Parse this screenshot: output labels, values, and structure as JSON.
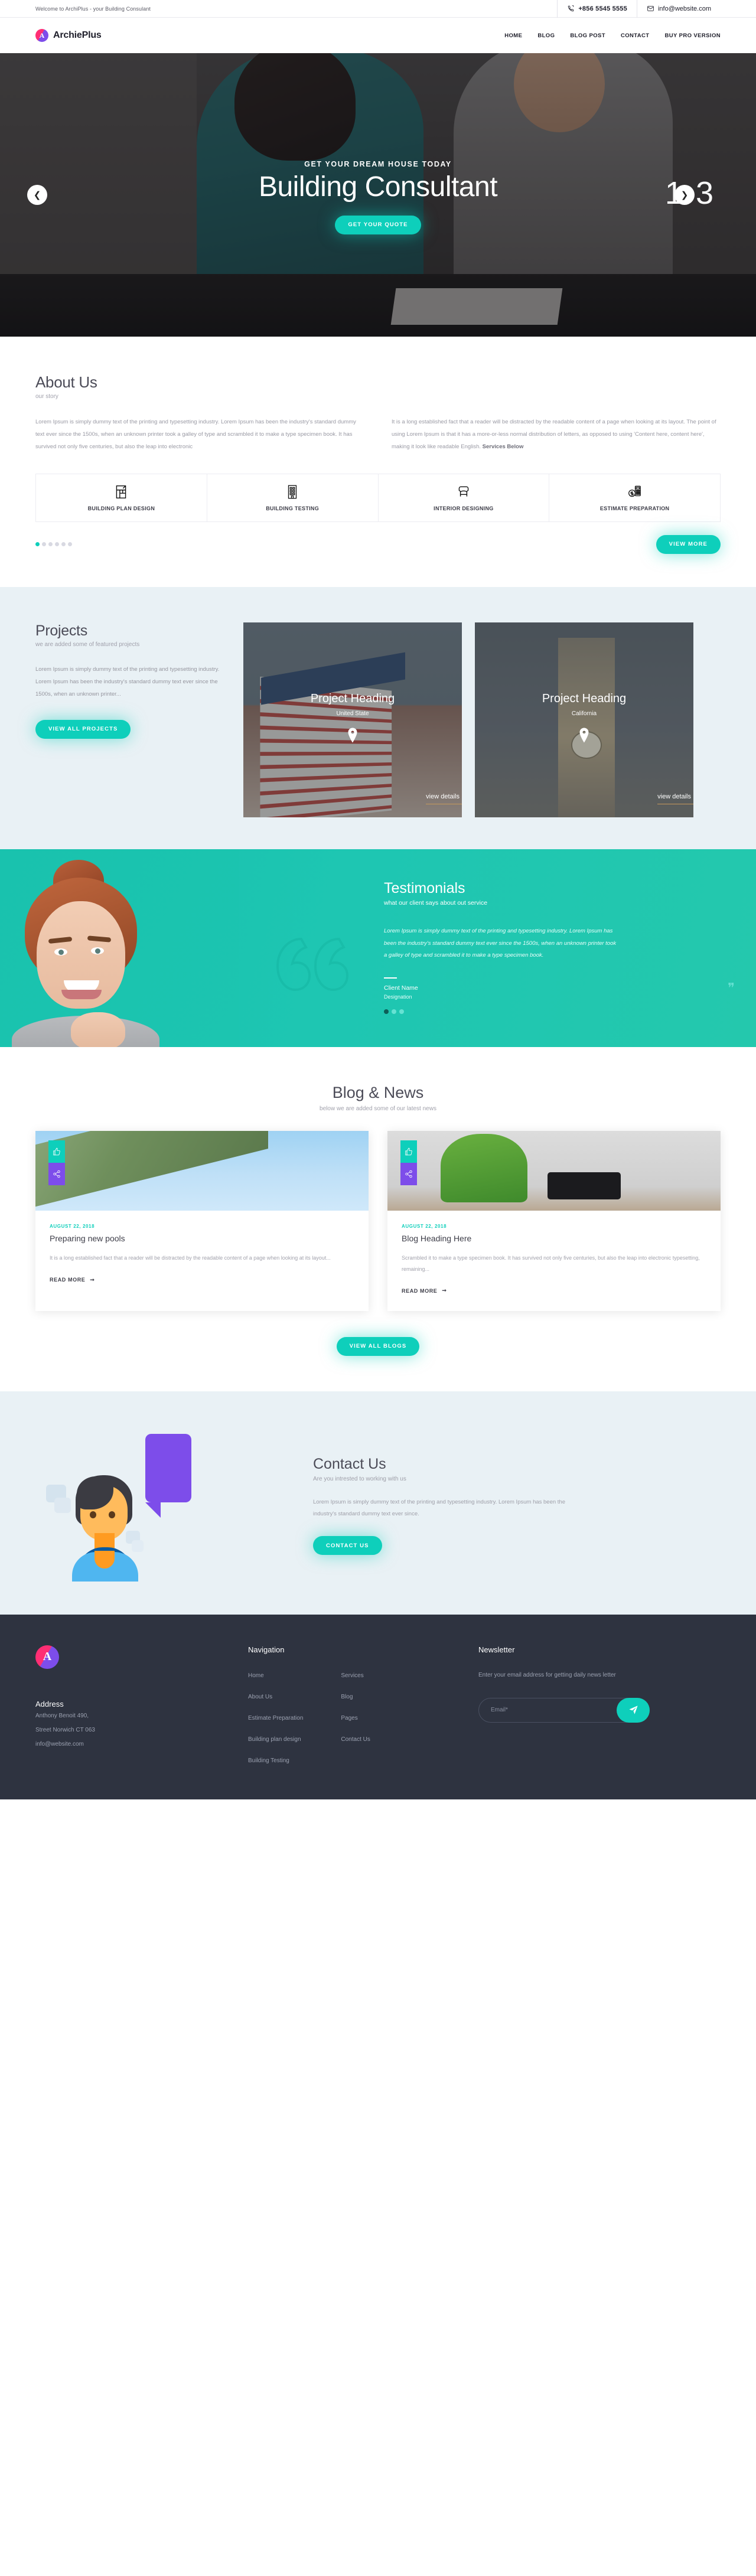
{
  "topbar": {
    "welcome": "Welcome to ArchiPlus - your Building Consulant",
    "phone": "+856 5545 5555",
    "email": "info@website.com",
    "phone_icon": "phone-icon",
    "mail_icon": "mail-icon"
  },
  "brand": {
    "initial": "A",
    "name": "ArchiePlus"
  },
  "nav": {
    "items": [
      "HOME",
      "BLOG",
      "BLOG POST",
      "CONTACT",
      "BUY PRO VERSION"
    ]
  },
  "hero": {
    "kicker": "GET YOUR DREAM HOUSE TODAY",
    "title": "Building Consultant",
    "cta": "GET YOUR QUOTE",
    "prev_icon": "chevron-left-icon",
    "next_icon": "chevron-right-icon",
    "slide_current": "1",
    "slide_total": "3"
  },
  "about": {
    "title": "About Us",
    "subtitle": "our story",
    "col1": "Lorem Ipsum is simply dummy text of the printing and typesetting industry. Lorem Ipsum has been the industry's standard dummy text ever since the 1500s, when an unknown printer took a galley of type and scrambled it to make a type specimen book. It has survived not only five centuries, but also the leap into electronic",
    "col2_lead": "It is a long established fact that a reader will be distracted by the readable content of a page when looking at its layout. The point of using Lorem Ipsum is that it has a more-or-less normal distribution of letters, as opposed to using 'Content here, content here', making it look like readable English. ",
    "col2_bold": "Services Below"
  },
  "services": {
    "items": [
      {
        "label": "BUILDING PLAN DESIGN",
        "icon": "floor-plan-icon"
      },
      {
        "label": "BUILDING TESTING",
        "icon": "building-icon"
      },
      {
        "label": "INTERIOR DESIGNING",
        "icon": "armchair-icon"
      },
      {
        "label": "ESTIMATE PREPARATION",
        "icon": "calculator-coin-icon"
      }
    ],
    "dot_count": 6,
    "active_dot": 0,
    "view_more": "VIEW MORE"
  },
  "projects": {
    "title": "Projects",
    "subtitle": "we are added some of featured projects",
    "description": "Lorem Ipsum is simply dummy text of the printing and typesetting industry. Lorem Ipsum has been the industry's standard dummy text ever since the 1500s, when an unknown printer...",
    "cta": "VIEW ALL PROJECTS",
    "cards": [
      {
        "heading": "Project Heading",
        "place": "United State",
        "link": "view details",
        "pin_icon": "map-pin-icon"
      },
      {
        "heading": "Project Heading",
        "place": "California",
        "link": "view details",
        "pin_icon": "map-pin-icon"
      }
    ]
  },
  "testimonials": {
    "title": "Testimonials",
    "subtitle": "what our client says about out service",
    "quote": "Lorem Ipsum is simply dummy text of the printing and typesetting industry. Lorem Ipsum has been the industry's standard dummy text ever since the 1500s, when an unknown printer took a galley of type and scrambled it to make a type specimen book.",
    "client_name": "Client Name",
    "client_role": "Designation",
    "dot_count": 3,
    "active_dot": 0,
    "quote_icon": "quote-mark-icon"
  },
  "blog": {
    "title": "Blog & News",
    "subtitle": "below we are added some of our latest news",
    "like_icon": "thumbs-up-icon",
    "share_icon": "share-icon",
    "posts": [
      {
        "date": "AUGUST 22, 2018",
        "title": "Preparing new pools",
        "excerpt": "It is a long established fact that a reader will be distracted by the readable content of a page when looking at its layout...",
        "more": "READ MORE"
      },
      {
        "date": "AUGUST 22, 2018",
        "title": "Blog Heading Here",
        "excerpt": "Scrambled it to make a type specimen book. It has survived not only five centuries, but also the leap into electronic typesetting, remaining...",
        "more": "READ MORE"
      }
    ],
    "view_all": "VIEW ALL BLOGS"
  },
  "contact": {
    "title": "Contact Us",
    "subtitle": "Are you intrested to working with us",
    "text": "Lorem Ipsum is simply dummy text of the printing and typesetting industry. Lorem Ipsum has been the industry's standard dummy text ever since.",
    "cta": "CONTACT US"
  },
  "footer": {
    "logo_initial": "A",
    "address_head": "Address",
    "address_line1": "Anthony Benoit 490,",
    "address_line2": "Street Norwich CT 063",
    "address_line3": "info@website.com",
    "nav_head": "Navigation",
    "nav_col1": [
      "Home",
      "About Us",
      "Estimate Preparation",
      "Building plan design",
      "Building Testing"
    ],
    "nav_col2": [
      "Services",
      "Blog",
      "Pages",
      "Contact Us"
    ],
    "newsletter_head": "Newsletter",
    "newsletter_text": "Enter your email address for getting daily news letter",
    "email_placeholder": "Email*",
    "email_value": "",
    "send_icon": "paper-plane-icon"
  },
  "colors": {
    "accent": "#0ecfbb",
    "purple": "#7d4dea",
    "pink": "#ff2e74",
    "dark": "#2e3340",
    "light_blue": "#e9f1f5"
  }
}
